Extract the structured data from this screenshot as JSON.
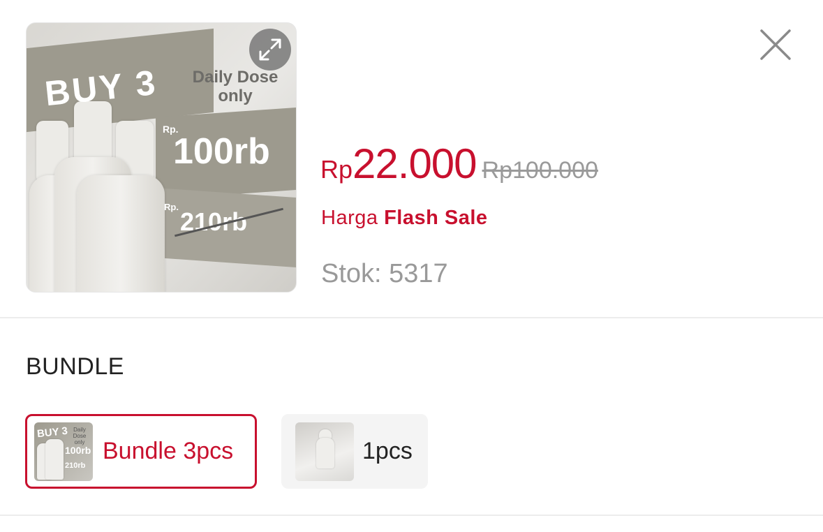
{
  "product": {
    "image": {
      "headline": "BUY 3",
      "subline": "Daily Dose only",
      "promo_currency": "Rp.",
      "promo_price": "100rb",
      "old_currency": "Rp.",
      "old_price": "210rb"
    },
    "expand_icon": "expand-icon",
    "close_icon": "close-icon"
  },
  "pricing": {
    "currency": "Rp",
    "price": "22.000",
    "original_price": "Rp100.000",
    "flash_prefix": "Harga",
    "flash_label": "Flash Sale",
    "stock": "Stok: 5317"
  },
  "variants": {
    "label": "BUNDLE",
    "options": [
      {
        "label": "Bundle 3pcs",
        "selected": true
      },
      {
        "label": "1pcs",
        "selected": false
      }
    ]
  },
  "colors": {
    "accent": "#c8102e",
    "muted": "#999999"
  }
}
